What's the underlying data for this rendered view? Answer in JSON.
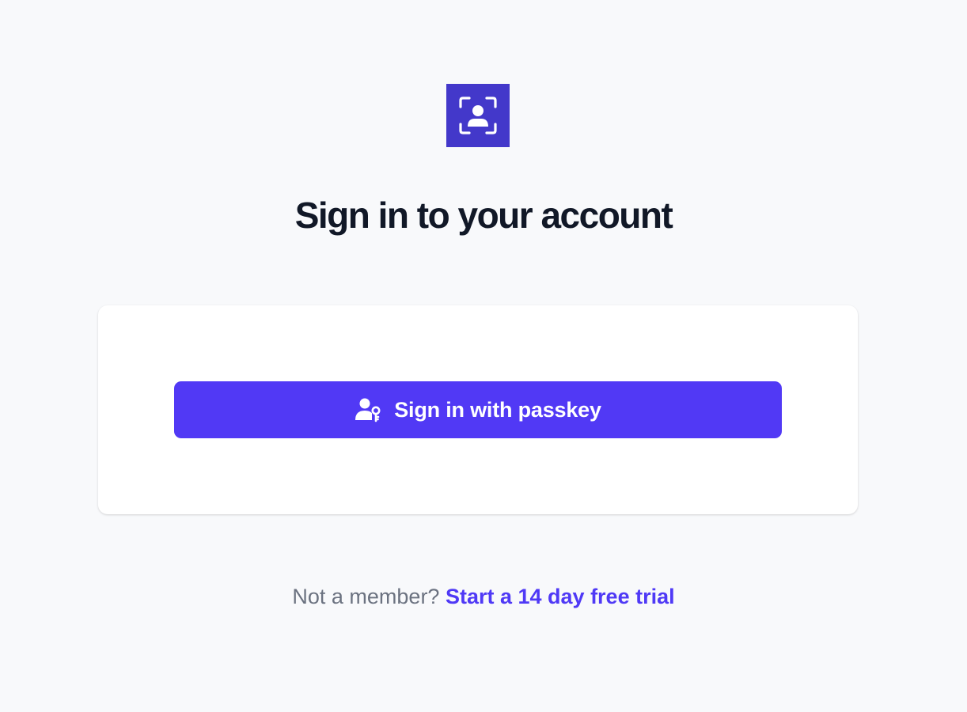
{
  "logo": {
    "icon": "user-scan-icon",
    "background": "#4338ca"
  },
  "header": {
    "title": "Sign in to your account"
  },
  "card": {
    "passkey_button": {
      "label": "Sign in with passkey",
      "icon": "user-key-icon",
      "color": "#5139f5"
    }
  },
  "footer": {
    "prompt": "Not a member?",
    "link_text": "Start a 14 day free trial",
    "link_color": "#4f39f6"
  }
}
